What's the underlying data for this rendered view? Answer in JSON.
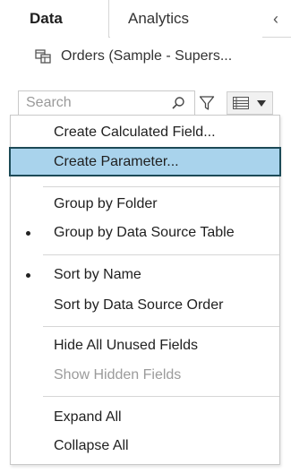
{
  "tabs": {
    "data_label": "Data",
    "analytics_label": "Analytics"
  },
  "datasource": {
    "name": "Orders (Sample - Supers...",
    "icon": "datasource-icon"
  },
  "search": {
    "placeholder": "Search"
  },
  "icons": {
    "search": "search-icon",
    "filter": "filter-icon",
    "view_data": "list-icon",
    "dropdown": "caret-down-icon",
    "collapse": "chevron-left-icon"
  },
  "menu": {
    "create_calculated_field": "Create Calculated Field...",
    "create_parameter": "Create Parameter...",
    "group_by_folder": "Group by Folder",
    "group_by_data_source_table": "Group by Data Source Table",
    "sort_by_name": "Sort by Name",
    "sort_by_data_source_order": "Sort by Data Source Order",
    "hide_all_unused_fields": "Hide All Unused Fields",
    "show_hidden_fields": "Show Hidden Fields",
    "expand_all": "Expand All",
    "collapse_all": "Collapse All"
  },
  "colors": {
    "highlight_fill": "#a9d3ec",
    "highlight_border": "#1c4a57",
    "disabled_text": "#9b9b9b"
  }
}
